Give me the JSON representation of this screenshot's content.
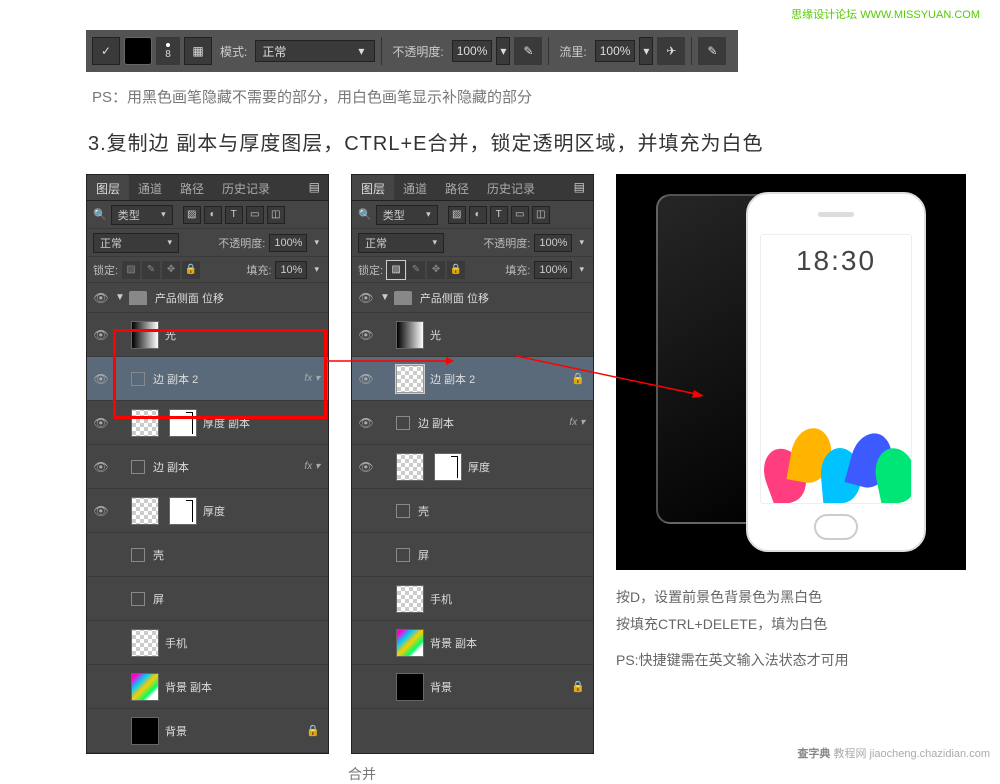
{
  "watermark_top": "思缘设计论坛  WWW.MISSYUAN.COM",
  "watermark_bot_brand": "查字典",
  "watermark_bot_text": "教程网  jiaocheng.chazidian.com",
  "options_bar": {
    "brush_size": "8",
    "mode_label": "模式:",
    "mode_value": "正常",
    "opacity_label": "不透明度:",
    "opacity_value": "100%",
    "flow_label": "流里:",
    "flow_value": "100%"
  },
  "caption_ps": "PS：用黑色画笔隐藏不需要的部分，用白色画笔显示补隐藏的部分",
  "step_title": "3.复制边 副本与厚度图层，CTRL+E合并，锁定透明区域，并填充为白色",
  "panel": {
    "tabs": [
      "图层",
      "通道",
      "路径",
      "历史记录"
    ],
    "kind_label": "类型",
    "blend_label": "正常",
    "opacity_label": "不透明度:",
    "opacity_value": "100%",
    "lock_label": "锁定:",
    "fill_label": "填充:",
    "fill_value_left": "10%",
    "fill_value_right": "100%",
    "group_name": "产品侧面 位移"
  },
  "layers_left": [
    {
      "name": "光",
      "thumb": "grad",
      "eye": true
    },
    {
      "name": "边 副本 2",
      "thumb": "none",
      "eye": true,
      "fx": true,
      "sel": true,
      "mask": null
    },
    {
      "name": "厚度 副本",
      "thumb": "checker",
      "mask": "maskwhite",
      "eye": true
    },
    {
      "name": "边 副本",
      "thumb": "none",
      "eye": true,
      "fx": true
    },
    {
      "name": "厚度",
      "thumb": "checker",
      "mask": "maskwhite",
      "eye": true
    },
    {
      "name": "壳",
      "thumb": "none",
      "eye": false
    },
    {
      "name": "屏",
      "thumb": "none",
      "eye": false
    },
    {
      "name": "手机",
      "thumb": "checker",
      "eye": false
    },
    {
      "name": "背景 副本",
      "thumb": "colorful",
      "eye": false
    },
    {
      "name": "背景",
      "thumb": "black",
      "eye": false,
      "lockicon": true
    }
  ],
  "layers_right": [
    {
      "name": "光",
      "thumb": "grad",
      "eye": true
    },
    {
      "name": "边 副本 2",
      "thumb": "checker-edge",
      "eye": true,
      "sel": true,
      "lockicon": true
    },
    {
      "name": "边 副本",
      "thumb": "none",
      "eye": true,
      "fx": true
    },
    {
      "name": "厚度",
      "thumb": "checker",
      "mask": "maskwhite",
      "eye": true
    },
    {
      "name": "壳",
      "thumb": "none",
      "eye": false
    },
    {
      "name": "屏",
      "thumb": "none",
      "eye": false
    },
    {
      "name": "手机",
      "thumb": "checker",
      "eye": false
    },
    {
      "name": "背景 副本",
      "thumb": "colorful",
      "eye": false
    },
    {
      "name": "背景",
      "thumb": "black",
      "eye": false,
      "lockicon": true
    }
  ],
  "panel2_caption": "合并",
  "phone": {
    "time": "18:30",
    "note1": "按D，设置前景色背景色为黑白色",
    "note2": "按填充CTRL+DELETE，填为白色",
    "note3": "PS:快捷键需在英文输入法状态才可用"
  }
}
